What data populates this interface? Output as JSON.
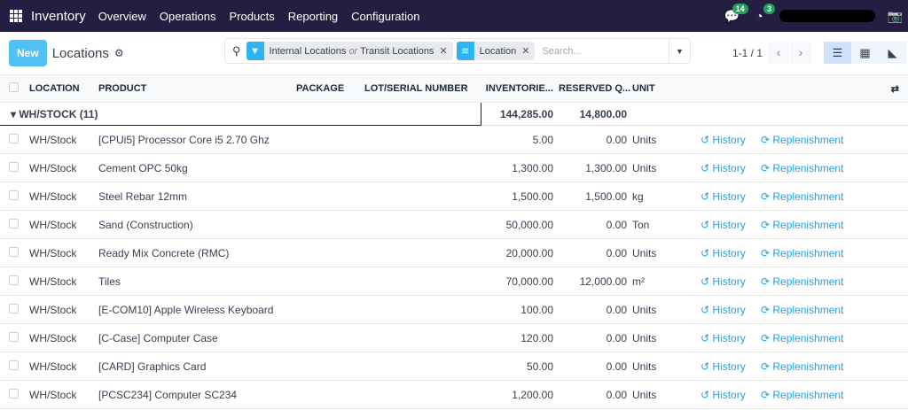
{
  "nav": {
    "brand": "Inventory",
    "menu": [
      "Overview",
      "Operations",
      "Products",
      "Reporting",
      "Configuration"
    ],
    "messages_count": "14",
    "activities_count": "3"
  },
  "control": {
    "new_label": "New",
    "title": "Locations",
    "facets": [
      {
        "text": "Internal Locations",
        "or": "or",
        "text2": "Transit Locations"
      },
      {
        "text": "Location"
      }
    ],
    "search_placeholder": "Search...",
    "pager": "1-1 / 1"
  },
  "table": {
    "headers": [
      "LOCATION",
      "PRODUCT",
      "PACKAGE",
      "LOT/SERIAL NUMBER",
      "INVENTORIE...",
      "RESERVED Q...",
      "UNIT"
    ],
    "group": {
      "label": "WH/STOCK (11)",
      "inventoried": "144,285.00",
      "reserved": "14,800.00"
    },
    "history_label": "History",
    "replenish_label": "Replenishment",
    "rows": [
      [
        "WH/Stock",
        "[CPUi5] Processor Core i5 2.70 Ghz",
        "5.00",
        "0.00",
        "Units"
      ],
      [
        "WH/Stock",
        "Cement OPC 50kg",
        "1,300.00",
        "1,300.00",
        "Units"
      ],
      [
        "WH/Stock",
        "Steel Rebar 12mm",
        "1,500.00",
        "1,500.00",
        "kg"
      ],
      [
        "WH/Stock",
        "Sand (Construction)",
        "50,000.00",
        "0.00",
        "Ton"
      ],
      [
        "WH/Stock",
        "Ready Mix Concrete (RMC)",
        "20,000.00",
        "0.00",
        "Units"
      ],
      [
        "WH/Stock",
        "Tiles",
        "70,000.00",
        "12,000.00",
        "m²"
      ],
      [
        "WH/Stock",
        "[E-COM10] Apple Wireless Keyboard",
        "100.00",
        "0.00",
        "Units"
      ],
      [
        "WH/Stock",
        "[C-Case] Computer Case",
        "120.00",
        "0.00",
        "Units"
      ],
      [
        "WH/Stock",
        "[CARD] Graphics Card",
        "50.00",
        "0.00",
        "Units"
      ],
      [
        "WH/Stock",
        "[PCSC234] Computer SC234",
        "1,200.00",
        "0.00",
        "Units"
      ]
    ]
  }
}
